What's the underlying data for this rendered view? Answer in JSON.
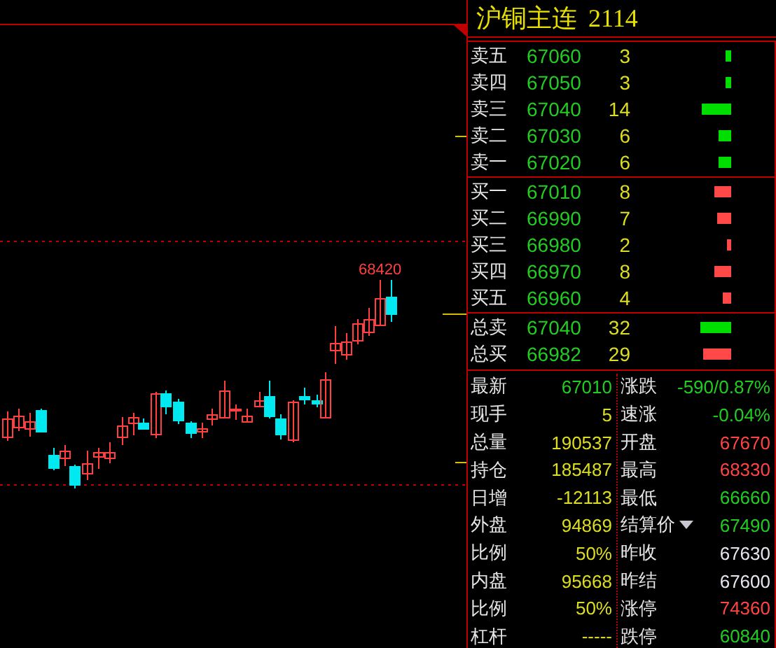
{
  "title": {
    "name": "沪铜主连",
    "code": "2114"
  },
  "chart": {
    "high_label": "68420"
  },
  "asks": [
    {
      "label": "卖五",
      "price": "67060",
      "volume": "3"
    },
    {
      "label": "卖四",
      "price": "67050",
      "volume": "3"
    },
    {
      "label": "卖三",
      "price": "67040",
      "volume": "14"
    },
    {
      "label": "卖二",
      "price": "67030",
      "volume": "6"
    },
    {
      "label": "卖一",
      "price": "67020",
      "volume": "6"
    }
  ],
  "bids": [
    {
      "label": "买一",
      "price": "67010",
      "volume": "8"
    },
    {
      "label": "买二",
      "price": "66990",
      "volume": "7"
    },
    {
      "label": "买三",
      "price": "66980",
      "volume": "2"
    },
    {
      "label": "买四",
      "price": "66970",
      "volume": "8"
    },
    {
      "label": "买五",
      "price": "66960",
      "volume": "4"
    }
  ],
  "totals": [
    {
      "label": "总卖",
      "price": "67040",
      "volume": "32"
    },
    {
      "label": "总买",
      "price": "66982",
      "volume": "29"
    }
  ],
  "stats_left": [
    {
      "label": "最新",
      "value": "67010",
      "color": "#22cc22"
    },
    {
      "label": "现手",
      "value": "5",
      "color": "#dddd22"
    },
    {
      "label": "总量",
      "value": "190537",
      "color": "#dddd22"
    },
    {
      "label": "持仓",
      "value": "185487",
      "color": "#dddd22"
    },
    {
      "label": "日增",
      "value": "-12113",
      "color": "#dddd22"
    },
    {
      "label": "外盘",
      "value": "94869",
      "color": "#dddd22"
    },
    {
      "label": "比例",
      "value": "50%",
      "color": "#dddd22"
    },
    {
      "label": "内盘",
      "value": "95668",
      "color": "#dddd22"
    },
    {
      "label": "比例",
      "value": "50%",
      "color": "#dddd22"
    },
    {
      "label": "杠杆",
      "value": "-----",
      "color": "#dddd22"
    }
  ],
  "stats_right": [
    {
      "label": "涨跌",
      "value": "-590/0.87%",
      "color": "#22cc22",
      "menu": false
    },
    {
      "label": "速涨",
      "value": "-0.04%",
      "color": "#22cc22",
      "menu": false
    },
    {
      "label": "开盘",
      "value": "67670",
      "color": "#ff4444",
      "menu": false
    },
    {
      "label": "最高",
      "value": "68330",
      "color": "#ff4444",
      "menu": false
    },
    {
      "label": "最低",
      "value": "66660",
      "color": "#22cc22",
      "menu": false
    },
    {
      "label": "结算价",
      "value": "67490",
      "color": "#22cc22",
      "menu": true
    },
    {
      "label": "昨收",
      "value": "67630",
      "color": "#e6e6f0",
      "menu": false
    },
    {
      "label": "昨结",
      "value": "67600",
      "color": "#e6e6f0",
      "menu": false
    },
    {
      "label": "涨停",
      "value": "74360",
      "color": "#ff4444",
      "menu": false
    },
    {
      "label": "跌停",
      "value": "60840",
      "color": "#22cc22",
      "menu": false
    }
  ]
}
